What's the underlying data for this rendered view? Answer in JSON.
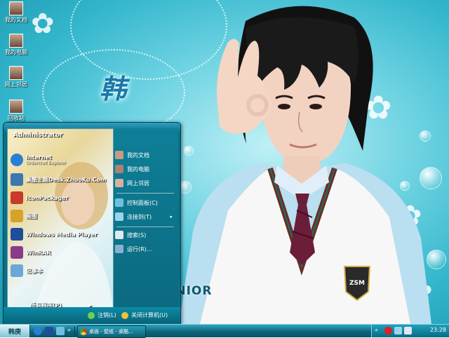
{
  "desktop_icons": [
    {
      "label": "我的文档",
      "icon": "documents-icon"
    },
    {
      "label": "我的电脑",
      "icon": "computer-icon"
    },
    {
      "label": "网上邻居",
      "icon": "network-icon"
    },
    {
      "label": "回收站",
      "icon": "recycle-bin-icon"
    }
  ],
  "wallpaper": {
    "hanzi": "韩",
    "banner": "SUPERJUNIOR",
    "badge": "ZSM"
  },
  "start_menu": {
    "user": "Administrator",
    "left_items": [
      {
        "title": "Internet",
        "sub": "Orderchet Explorer",
        "icon": "ie-icon",
        "color": "#2a7fd4"
      },
      {
        "title": "桌酷主题Desk.ZhuoKu.Com",
        "sub": "",
        "icon": "zhuoku-icon",
        "color": "#3b77b0"
      },
      {
        "title": "IconPackager",
        "sub": "",
        "icon": "iconpackager-icon",
        "color": "#c83b2a"
      },
      {
        "title": "画图",
        "sub": "",
        "icon": "paint-icon",
        "color": "#d6a22a"
      },
      {
        "title": "Windows Media Player",
        "sub": "",
        "icon": "media-player-icon",
        "color": "#1e4e9a"
      },
      {
        "title": "WinRAR",
        "sub": "",
        "icon": "winrar-icon",
        "color": "#8a3a8a"
      },
      {
        "title": "记事本",
        "sub": "",
        "icon": "notepad-icon",
        "color": "#6aa8d8"
      }
    ],
    "all_programs": "所有程序(P)",
    "right_items": [
      {
        "label": "我的文档",
        "icon": "my-documents-icon",
        "more": ""
      },
      {
        "label": "我的电脑",
        "icon": "my-computer-icon",
        "more": ""
      },
      {
        "label": "网上邻居",
        "icon": "my-network-icon",
        "more": ""
      },
      {
        "label": "控制面板(C)",
        "icon": "control-panel-icon",
        "more": ""
      },
      {
        "label": "连接到(T)",
        "icon": "connect-to-icon",
        "more": "▸"
      },
      {
        "label": "搜索(S)",
        "icon": "search-icon",
        "more": ""
      },
      {
        "label": "运行(R)...",
        "icon": "run-icon",
        "more": ""
      }
    ],
    "logoff": "注销(L)",
    "shutdown": "关闭计算机(U)"
  },
  "taskbar": {
    "start_label": "韩庚",
    "quick_launch_arrow": "»",
    "task_label": "桌面 - 壁纸 - 桌酷...",
    "tray_arrow": "«",
    "clock": "23:28"
  }
}
